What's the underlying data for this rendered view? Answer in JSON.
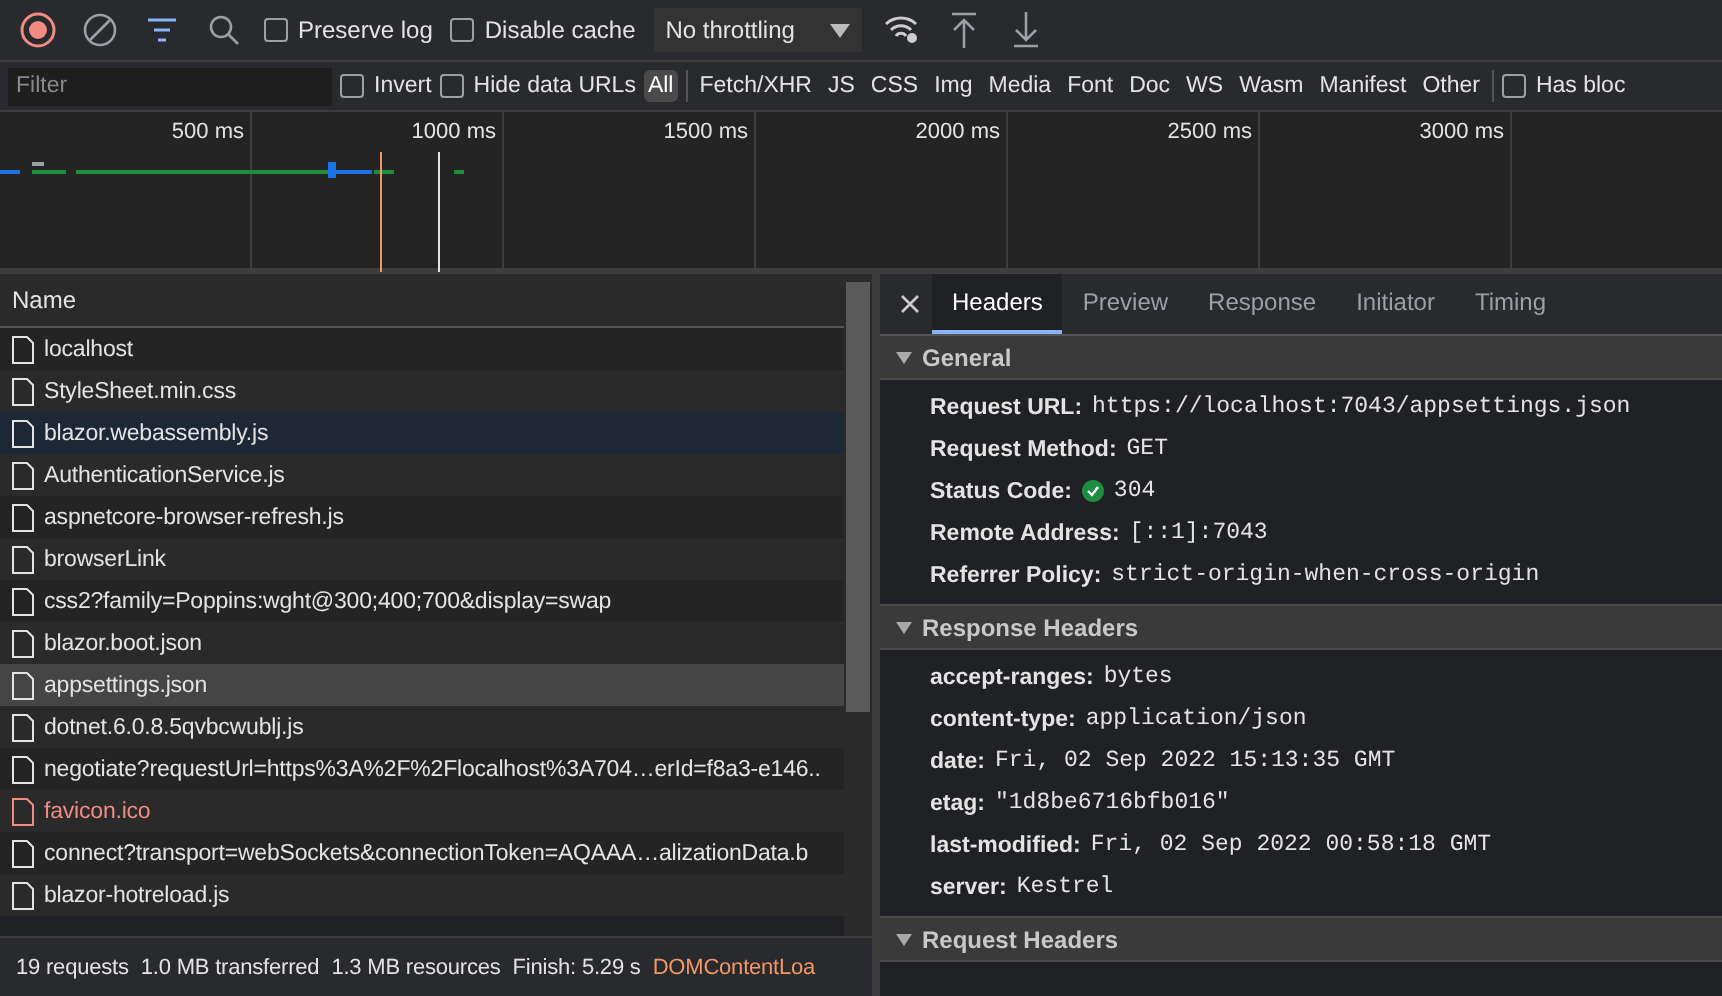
{
  "toolbar": {
    "recording": true,
    "filter_active": true,
    "checkboxes": [
      {
        "label": "Preserve log",
        "checked": false
      },
      {
        "label": "Disable cache",
        "checked": false
      }
    ],
    "throttling": "No throttling"
  },
  "filter_bar": {
    "placeholder": "Filter",
    "checkboxes": [
      {
        "label": "Invert",
        "checked": false
      },
      {
        "label": "Hide data URLs",
        "checked": false
      }
    ],
    "types": [
      {
        "label": "All",
        "selected": true
      },
      {
        "label": "Fetch/XHR",
        "selected": false
      },
      {
        "label": "JS",
        "selected": false
      },
      {
        "label": "CSS",
        "selected": false
      },
      {
        "label": "Img",
        "selected": false
      },
      {
        "label": "Media",
        "selected": false
      },
      {
        "label": "Font",
        "selected": false
      },
      {
        "label": "Doc",
        "selected": false
      },
      {
        "label": "WS",
        "selected": false
      },
      {
        "label": "Wasm",
        "selected": false
      },
      {
        "label": "Manifest",
        "selected": false
      },
      {
        "label": "Other",
        "selected": false
      }
    ],
    "extra_checkbox": {
      "label": "Has bloc",
      "checked": false
    }
  },
  "overview": {
    "ticks": [
      "500 ms",
      "1000 ms",
      "1500 ms",
      "2000 ms",
      "2500 ms",
      "3000 ms"
    ]
  },
  "requests": {
    "column": "Name",
    "rows": [
      {
        "name": "localhost",
        "selected": false,
        "hovered": false,
        "failed": false
      },
      {
        "name": "StyleSheet.min.css",
        "selected": false,
        "hovered": false,
        "failed": false
      },
      {
        "name": "blazor.webassembly.js",
        "selected": false,
        "hovered": true,
        "failed": false
      },
      {
        "name": "AuthenticationService.js",
        "selected": false,
        "hovered": false,
        "failed": false
      },
      {
        "name": "aspnetcore-browser-refresh.js",
        "selected": false,
        "hovered": false,
        "failed": false
      },
      {
        "name": "browserLink",
        "selected": false,
        "hovered": false,
        "failed": false
      },
      {
        "name": "css2?family=Poppins:wght@300;400;700&display=swap",
        "selected": false,
        "hovered": false,
        "failed": false
      },
      {
        "name": "blazor.boot.json",
        "selected": false,
        "hovered": false,
        "failed": false
      },
      {
        "name": "appsettings.json",
        "selected": true,
        "hovered": false,
        "failed": false
      },
      {
        "name": "dotnet.6.0.8.5qvbcwublj.js",
        "selected": false,
        "hovered": false,
        "failed": false
      },
      {
        "name": "negotiate?requestUrl=https%3A%2F%2Flocalhost%3A704…erId=f8a3-e146..",
        "selected": false,
        "hovered": false,
        "failed": false
      },
      {
        "name": "favicon.ico",
        "selected": false,
        "hovered": false,
        "failed": true
      },
      {
        "name": "connect?transport=webSockets&connectionToken=AQAAA…alizationData.b",
        "selected": false,
        "hovered": false,
        "failed": false
      },
      {
        "name": "blazor-hotreload.js",
        "selected": false,
        "hovered": false,
        "failed": false
      }
    ]
  },
  "status_bar": [
    {
      "text": "19 requests",
      "kind": "plain"
    },
    {
      "text": "1.0 MB transferred",
      "kind": "plain"
    },
    {
      "text": "1.3 MB resources",
      "kind": "plain"
    },
    {
      "text": "Finish: 5.29 s",
      "kind": "plain"
    },
    {
      "text": "DOMContentLoa",
      "kind": "dom"
    }
  ],
  "detail": {
    "tabs": [
      {
        "label": "Headers",
        "selected": true
      },
      {
        "label": "Preview",
        "selected": false
      },
      {
        "label": "Response",
        "selected": false
      },
      {
        "label": "Initiator",
        "selected": false
      },
      {
        "label": "Timing",
        "selected": false
      }
    ],
    "sections": [
      {
        "title": "General",
        "expanded": true,
        "rows": [
          {
            "key": "Request URL:",
            "value": "https://localhost:7043/appsettings.json",
            "ok": false
          },
          {
            "key": "Request Method:",
            "value": "GET",
            "ok": false
          },
          {
            "key": "Status Code:",
            "value": "304",
            "ok": true
          },
          {
            "key": "Remote Address:",
            "value": "[::1]:7043",
            "ok": false
          },
          {
            "key": "Referrer Policy:",
            "value": "strict-origin-when-cross-origin",
            "ok": false
          }
        ]
      },
      {
        "title": "Response Headers",
        "expanded": true,
        "rows": [
          {
            "key": "accept-ranges:",
            "value": "bytes",
            "ok": false
          },
          {
            "key": "content-type:",
            "value": "application/json",
            "ok": false
          },
          {
            "key": "date:",
            "value": "Fri, 02 Sep 2022 15:13:35 GMT",
            "ok": false
          },
          {
            "key": "etag:",
            "value": "\"1d8be6716bfb016\"",
            "ok": false
          },
          {
            "key": "last-modified:",
            "value": "Fri, 02 Sep 2022 00:58:18 GMT",
            "ok": false
          },
          {
            "key": "server:",
            "value": "Kestrel",
            "ok": false
          }
        ]
      },
      {
        "title": "Request Headers",
        "expanded": true
      }
    ]
  }
}
